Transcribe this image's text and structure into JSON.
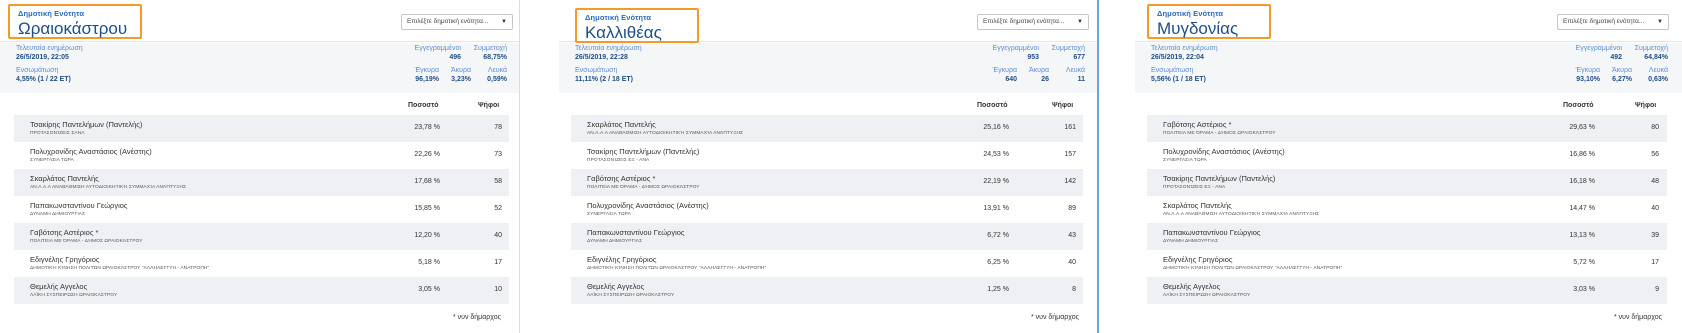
{
  "colors": {
    "accent_orange": "#f39a2b",
    "title_blue": "#1f4f86",
    "label_blue": "#5b8fcf",
    "row_shade": "#eef0f3",
    "divider_blue": "#6fa5dc"
  },
  "panels": [
    {
      "unit_label": "Δημοτική Ενότητα",
      "municipality": "Ωραιοκάστρου",
      "select_placeholder": "Επιλέξτε δημοτική ενότητα...",
      "summary": {
        "last_update_label": "Τελευταία ενημέρωση",
        "last_update_value": "26/5/2019, 22:05",
        "registered_label": "Εγγεγραμμένοι",
        "registered_value": "496",
        "turnout_label": "Συμμετοχή",
        "turnout_value": "68,75%",
        "counted_label": "Ενσωμάτωση",
        "counted_value": "4,55% (1 / 22 ΕΤ)",
        "valid_label": "Έγκυρα",
        "valid_value": "96,19%",
        "invalid_label": "Άκυρα",
        "invalid_value": "3,23%",
        "blank_label": "Λευκά",
        "blank_value": "0,59%"
      },
      "col_pct": "Ποσοστό",
      "col_votes": "Ψήφοι",
      "candidates": [
        {
          "name": "Τσακίρης Παντελήμων (Παντελής)",
          "party": "Προτασονίζεις ΣΑΝΑ",
          "pct": "23,78 %",
          "votes": "78"
        },
        {
          "name": "Πολυχρονίδης Αναστάσιος (Ανέστης)",
          "party": "ΣΥΝΕΡΓΑΣΙΑ ΤΩΡΑ",
          "pct": "22,26 %",
          "votes": "73"
        },
        {
          "name": "Σκαρλάτος Παντελής",
          "party": "Αν.α.α.α Αναβάθμιση Αυτοδιοικητική Συμμαχία Ανάπτυξης",
          "pct": "17,68 %",
          "votes": "58"
        },
        {
          "name": "Παπακωνσταντίνου Γεώργιος",
          "party": "ΔΥΝΑΜΗ ΔΗΜΙΟΥΡΓΙΑΣ",
          "pct": "15,85 %",
          "votes": "52"
        },
        {
          "name": "Γαβότσης Αστέριος *",
          "party": "ΠΟΛΙΤΕΙΑ με όραμα - Δήμος Ωραιοκάστρου",
          "pct": "12,20 %",
          "votes": "40"
        },
        {
          "name": "Εδιγνέλης Γρηγόριος",
          "party": "Δημοτική Κίνηση Πολιτών Ωραιοκάστρου \"ΑΛΛΗΛΕΓΓΥΗ - ΑΝΑΤΡΟΠΗ\"",
          "pct": "5,18 %",
          "votes": "17"
        },
        {
          "name": "Θεμελής Αγγελος",
          "party": "ΛΑΪΚΗ ΣΥΣΠΕΙΡΩΣΗ ΩΡΑΙΟΚΑΣΤΡΟΥ",
          "pct": "3,05 %",
          "votes": "10"
        }
      ],
      "footnote": "* νυν δήμαρχος"
    },
    {
      "unit_label": "Δημοτική Ενότητα",
      "municipality": "Καλλιθέας",
      "select_placeholder": "Επιλέξτε δημοτική ενότητα...",
      "summary": {
        "last_update_label": "Τελευταία ενημέρωση",
        "last_update_value": "26/5/2019, 22:28",
        "registered_label": "Εγγεγραμμένοι",
        "registered_value": "953",
        "turnout_label": "Συμμετοχή",
        "turnout_value": "677",
        "counted_label": "Ενσωμάτωση",
        "counted_value": "11,11% (2 / 18 ΕΤ)",
        "valid_label": "Έγκυρα",
        "valid_value": "640",
        "invalid_label": "Άκυρα",
        "invalid_value": "26",
        "blank_label": "Λευκά",
        "blank_value": "11"
      },
      "col_pct": "Ποσοστό",
      "col_votes": "Ψήφοι",
      "candidates": [
        {
          "name": "Σκαρλάτος Παντελής",
          "party": "Αν.α.α.α Αναβάθμιση Αυτοδιοικητική Συμμαχία Ανάπτυξης",
          "pct": "25,16 %",
          "votes": "161"
        },
        {
          "name": "Τσακίρης Παντελήμων (Παντελής)",
          "party": "Προτασονίζεις ΕΞ - ΑΝΑ",
          "pct": "24,53 %",
          "votes": "157"
        },
        {
          "name": "Γαβότσης Αστέριος *",
          "party": "ΠΟΛΙΤΕΙΑ με όραμα - Δήμος Ωραιοκάστρου",
          "pct": "22,19 %",
          "votes": "142"
        },
        {
          "name": "Πολυχρονίδης Αναστάσιος (Ανέστης)",
          "party": "ΣΥΝΕΡΓΑΣΙΑ ΤΩΡΑ",
          "pct": "13,91 %",
          "votes": "89"
        },
        {
          "name": "Παπακωνσταντίνου Γεώργιος",
          "party": "ΔΥΝΑΜΗ ΔΗΜΙΟΥΡΓΙΑΣ",
          "pct": "6,72 %",
          "votes": "43"
        },
        {
          "name": "Εδιγνέλης Γρηγόριος",
          "party": "Δημοτική Κίνηση Πολιτών Ωραιοκάστρου \"ΑΛΛΗΛΕΓΓΥΗ - ΑΝΑΤΡΟΠΗ\"",
          "pct": "6,25 %",
          "votes": "40"
        },
        {
          "name": "Θεμελής Αγγελος",
          "party": "ΛΑΪΚΗ ΣΥΣΠΕΙΡΩΣΗ ΩΡΑΙΟΚΑΣΤΡΟΥ",
          "pct": "1,25 %",
          "votes": "8"
        }
      ],
      "footnote": "* νυν δήμαρχος"
    },
    {
      "unit_label": "Δημοτική Ενότητα",
      "municipality": "Μυγδονίας",
      "select_placeholder": "Επιλέξτε δημοτική ενότητα...",
      "summary": {
        "last_update_label": "Τελευταία ενημέρωση",
        "last_update_value": "26/5/2019, 22:04",
        "registered_label": "Εγγεγραμμένοι",
        "registered_value": "492",
        "turnout_label": "Συμμετοχή",
        "turnout_value": "64,84%",
        "counted_label": "Ενσωμάτωση",
        "counted_value": "5,56% (1 / 18 ΕΤ)",
        "valid_label": "Έγκυρα",
        "valid_value": "93,10%",
        "invalid_label": "Άκυρα",
        "invalid_value": "6,27%",
        "blank_label": "Λευκά",
        "blank_value": "0,63%"
      },
      "col_pct": "Ποσοστό",
      "col_votes": "Ψήφοι",
      "candidates": [
        {
          "name": "Γαβότσης Αστέριος *",
          "party": "ΠΟΛΙΤΕΙΑ με όραμα - Δήμος Ωραιοκάστρου",
          "pct": "29,63 %",
          "votes": "80"
        },
        {
          "name": "Πολυχρονίδης Αναστάσιος (Ανέστης)",
          "party": "ΣΥΝΕΡΓΑΣΙΑ ΤΩΡΑ",
          "pct": "16,86 %",
          "votes": "56"
        },
        {
          "name": "Τσακίρης Παντελήμων (Παντελής)",
          "party": "Προτασονίζεις ΕΞ - ΑΝΑ",
          "pct": "16,18 %",
          "votes": "48"
        },
        {
          "name": "Σκαρλάτος Παντελής",
          "party": "Αν.α.α.α Αναβάθμιση Αυτοδιοικητική Συμμαχία Ανάπτυξης",
          "pct": "14,47 %",
          "votes": "40"
        },
        {
          "name": "Παπακωνσταντίνου Γεώργιος",
          "party": "ΔΥΝΑΜΗ ΔΗΜΙΟΥΡΓΙΑΣ",
          "pct": "13,13 %",
          "votes": "39"
        },
        {
          "name": "Εδιγνέλης Γρηγόριος",
          "party": "Δημοτική Κίνηση Πολιτών Ωραιοκάστρου \"ΑΛΛΗΛΕΓΓΥΗ - ΑΝΑΤΡΟΠΗ\"",
          "pct": "5,72 %",
          "votes": "17"
        },
        {
          "name": "Θεμελής Αγγελος",
          "party": "ΛΑΪΚΗ ΣΥΣΠΕΙΡΩΣΗ ΩΡΑΙΟΚΑΣΤΡΟΥ",
          "pct": "3,03 %",
          "votes": "9"
        }
      ],
      "footnote": "* νυν δήμαρχος"
    }
  ]
}
